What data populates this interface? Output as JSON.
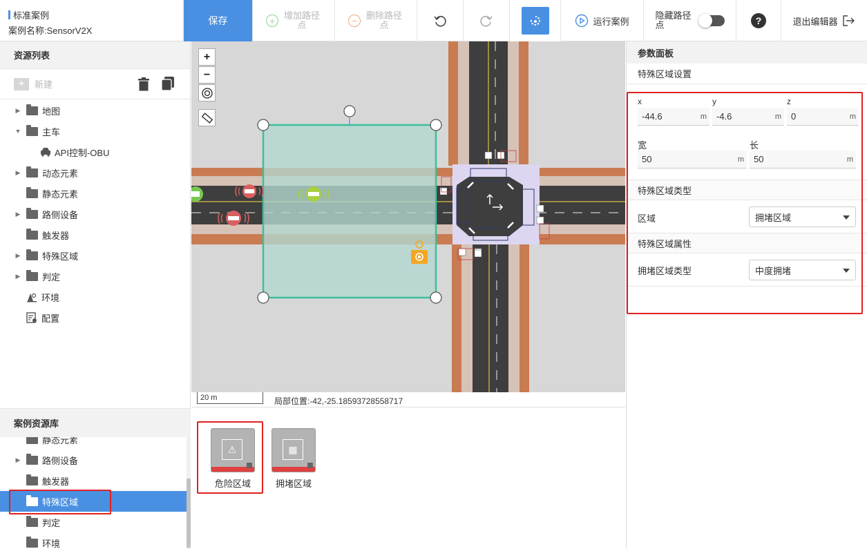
{
  "header": {
    "case_type": "标准案例",
    "case_name": "案例名称:SensorV2X",
    "save": "保存",
    "add_waypoint": "增加路径点",
    "delete_waypoint": "删除路径点",
    "run_case": "运行案例",
    "hide_path": "隐藏路径点",
    "help": "?",
    "exit_editor": "退出编辑器"
  },
  "resource_list": {
    "title": "资源列表",
    "new": "新建",
    "tree": [
      {
        "label": "地图",
        "expandable": true,
        "expanded": false
      },
      {
        "label": "主车",
        "expandable": true,
        "expanded": true
      },
      {
        "label": "API控制-OBU",
        "child": true
      },
      {
        "label": "动态元素",
        "expandable": true,
        "expanded": false
      },
      {
        "label": "静态元素",
        "expandable": false
      },
      {
        "label": "路侧设备",
        "expandable": true,
        "expanded": false
      },
      {
        "label": "触发器",
        "expandable": false
      },
      {
        "label": "特殊区域",
        "expandable": true,
        "expanded": false
      },
      {
        "label": "判定",
        "expandable": true,
        "expanded": false
      },
      {
        "label": "环境",
        "icon": "environment-icon"
      },
      {
        "label": "配置",
        "icon": "config-icon"
      }
    ]
  },
  "case_library": {
    "title": "案例资源库",
    "items": [
      {
        "label": "静态元素",
        "expandable": false
      },
      {
        "label": "路侧设备",
        "expandable": true
      },
      {
        "label": "触发器",
        "expandable": false
      },
      {
        "label": "特殊区域",
        "expandable": false,
        "selected": true
      },
      {
        "label": "判定",
        "expandable": false
      },
      {
        "label": "环境",
        "expandable": false
      }
    ]
  },
  "map": {
    "zoom_in": "+",
    "zoom_out": "−",
    "scale": "20 m",
    "position": "局部位置:-42,-25.18593728558717"
  },
  "assets": [
    {
      "label": "危险区域",
      "icon": "warning-icon"
    },
    {
      "label": "拥堵区域",
      "icon": "congestion-icon"
    }
  ],
  "params": {
    "title": "参数面板",
    "section_setting": "特殊区域设置",
    "x_label": "x",
    "x_value": "-44.6",
    "x_unit": "m",
    "y_label": "y",
    "y_value": "-4.6",
    "y_unit": "m",
    "z_label": "z",
    "z_value": "0",
    "z_unit": "m",
    "width_label": "宽",
    "width_value": "50",
    "width_unit": "m",
    "length_label": "长",
    "length_value": "50",
    "length_unit": "m",
    "section_type": "特殊区域类型",
    "region_label": "区域",
    "region_value": "拥堵区域",
    "section_attr": "特殊区域属性",
    "congestion_label": "拥堵区域类型",
    "congestion_value": "中度拥堵"
  },
  "colors": {
    "accent": "#4a90e2",
    "highlight_box": "#e02020",
    "zone_border": "#3dbf9a",
    "zone_fill": "#b3d8d0"
  }
}
